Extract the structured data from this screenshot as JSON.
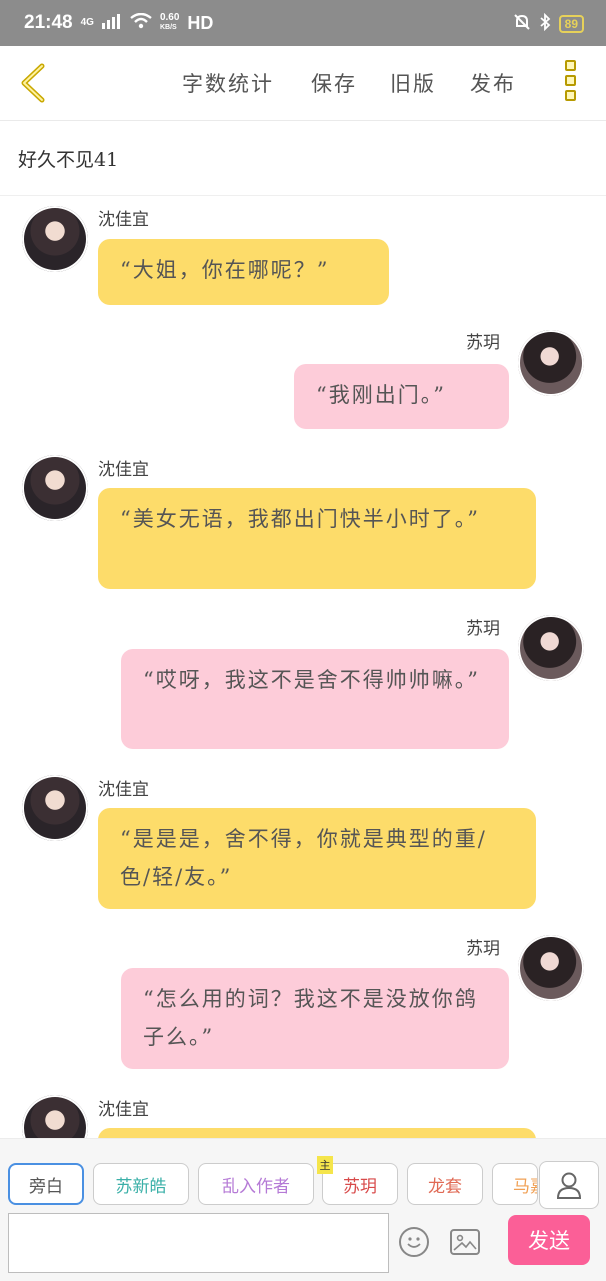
{
  "status": {
    "time": "21:48",
    "network": "4G",
    "speed_value": "0.60",
    "speed_unit": "KB/S",
    "hd": "HD",
    "battery": "89"
  },
  "toolbar": {
    "word_count": "字数统计",
    "save": "保存",
    "old_version": "旧版",
    "publish": "发布"
  },
  "chapter_title": "好久不见41",
  "messages": [
    {
      "sender": "沈佳宜",
      "text": "“大姐，你在哪呢？”",
      "color": "#fddc6a"
    },
    {
      "sender": "苏玥",
      "text": "“我刚出门。”",
      "color": "#fdccd9"
    },
    {
      "sender": "沈佳宜",
      "text": "“美女无语，我都出门快半小时了。”",
      "color": "#fddc6a"
    },
    {
      "sender": "苏玥",
      "text": "“哎呀，我这不是舍不得帅帅嘛。”",
      "color": "#fdccd9"
    },
    {
      "sender": "沈佳宜",
      "text": "“是是是，舍不得，你就是典型的重/色/轻/友。”",
      "color": "#fddc6a"
    },
    {
      "sender": "苏玥",
      "text": "“怎么用的词？我这不是没放你鸽子么。”",
      "color": "#fdccd9"
    },
    {
      "sender": "沈佳宜",
      "text": "",
      "color": "#fddc6a"
    }
  ],
  "roles": [
    {
      "label": "旁白",
      "color": "#555555"
    },
    {
      "label": "苏新皓",
      "color": "#3bb0a8"
    },
    {
      "label": "乱入作者",
      "color": "#b57ad6"
    },
    {
      "label": "苏玥",
      "color": "#d84a4a",
      "badge": "主"
    },
    {
      "label": "龙套",
      "color": "#e06a55"
    },
    {
      "label": "马嘉",
      "color": "#f0a054"
    }
  ],
  "send_label": "发送",
  "icons": {
    "back": "chevron-left-icon",
    "more": "more-vertical-icon",
    "emoji": "emoji-icon",
    "image": "image-icon",
    "profile": "person-icon"
  },
  "colors": {
    "accent": "#fb5f97",
    "yellow_bubble": "#fddc6a",
    "pink_bubble": "#fdccd9",
    "back_icon": "#c9a800"
  }
}
